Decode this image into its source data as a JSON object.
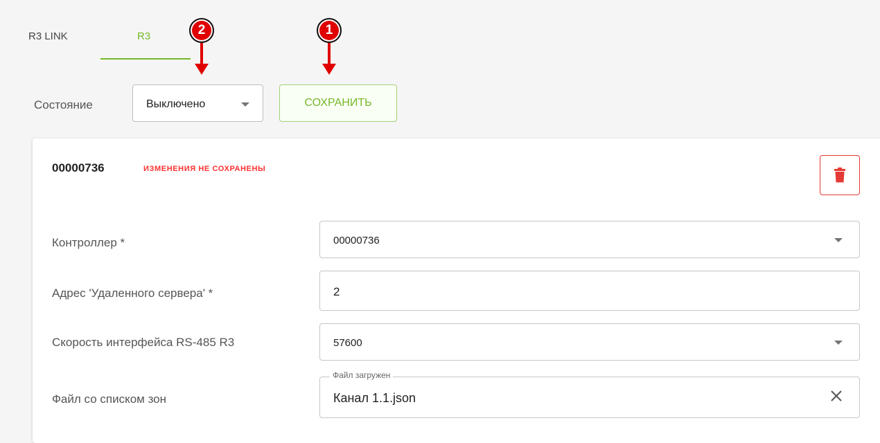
{
  "tabs": [
    {
      "label": "R3 LINK",
      "active": false
    },
    {
      "label": "R3",
      "active": true
    }
  ],
  "markers": [
    {
      "number": "2"
    },
    {
      "number": "1"
    }
  ],
  "state": {
    "label": "Состояние",
    "value": "Выключено"
  },
  "toolbar": {
    "save_label": "СОХРАНИТЬ"
  },
  "card": {
    "id": "00000736",
    "warning": "ИЗМЕНЕНИЯ НЕ СОХРАНЕНЫ",
    "delete_icon": "trash-icon"
  },
  "fields": {
    "controller": {
      "label": "Контроллер *",
      "value": "00000736"
    },
    "server_address": {
      "label": "Адрес 'Удаленного сервера' *",
      "value": "2"
    },
    "rs485_speed": {
      "label": "Скорость интерфейса RS-485 R3",
      "value": "57600"
    },
    "zones_file": {
      "label": "Файл со списком зон",
      "legend": "Файл загружен",
      "value": "Канал 1.1.json"
    }
  },
  "colors": {
    "accent": "#76b82a",
    "danger": "#e53935",
    "marker": "#e00000"
  }
}
